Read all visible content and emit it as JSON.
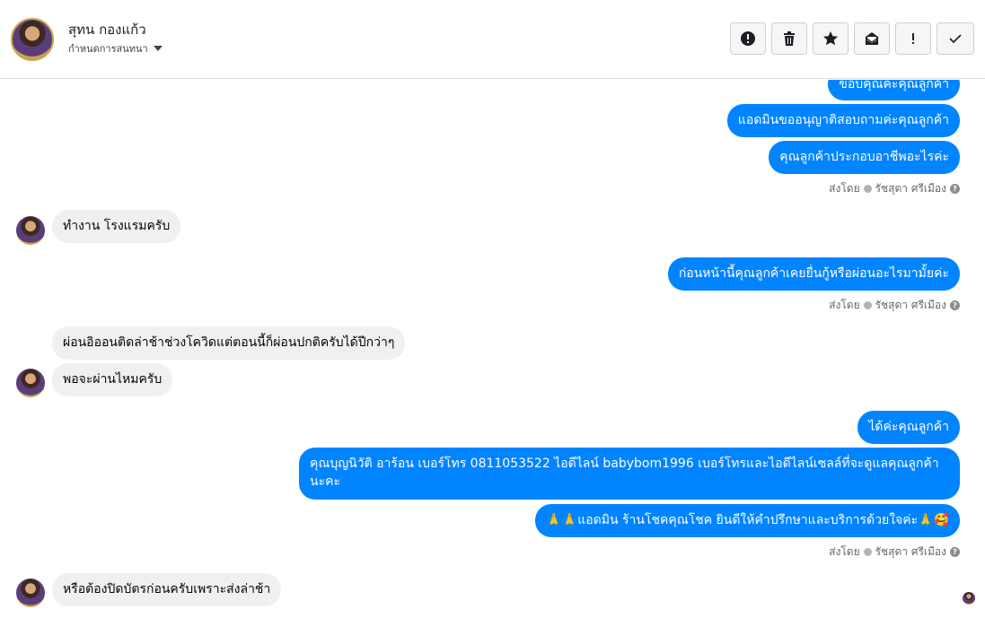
{
  "header": {
    "name": "สุทน กองแก้ว",
    "subtitle": "กำหนดการสนทนา",
    "toolbar": [
      {
        "icon": "alert-circle-icon"
      },
      {
        "icon": "trash-icon"
      },
      {
        "icon": "star-icon"
      },
      {
        "icon": "envelope-icon"
      },
      {
        "icon": "exclamation-icon"
      },
      {
        "icon": "checkmark-icon"
      }
    ]
  },
  "messages": {
    "m1": "ขอบคุณค่ะคุณลูกค้า",
    "m2": "แอดมินขออนุญาติสอบถามค่ะคุณลูกค้า",
    "m3": "คุณลูกค้าประกอบอาชีพอะไรค่ะ",
    "m4": "ทำงาน โรงแรมครับ",
    "m5": "ก่อนหน้านี้คุณลูกค้าเคยยื่นกู้หรือผ่อนอะไรมามั้ยค่ะ",
    "m6": "ผ่อนอิออนติดล่าช้าช่วงโควิดแต่ตอนนี้ก็ผ่อนปกติครับได้ปีกว่าๆ",
    "m7": "พอจะผ่านไหมครับ",
    "m8": "ได้ค่ะคุณลูกค้า",
    "m9": "คุณบุญนิวัติ  อาร้อน        เบอร์โทร 0811053522  ไอดีไลน์ babybom1996   เบอร์โทรและไอดีไลน์เซลล์ที่จะดูแลคุณลูกค้านะคะ",
    "m10": "🙏🙏แอดมิน ร้านโชคคุณโชค ยินดีให้คำปรึกษาและบริการด้วยใจค่ะ🙏🥰",
    "m11": "หรือต้องปิดบัตรก่อนครับเพราะส่งล่าช้า"
  },
  "sent_by": {
    "label": "ส่งโดย",
    "agent": "รัชสุดา ศรีเมือง"
  }
}
